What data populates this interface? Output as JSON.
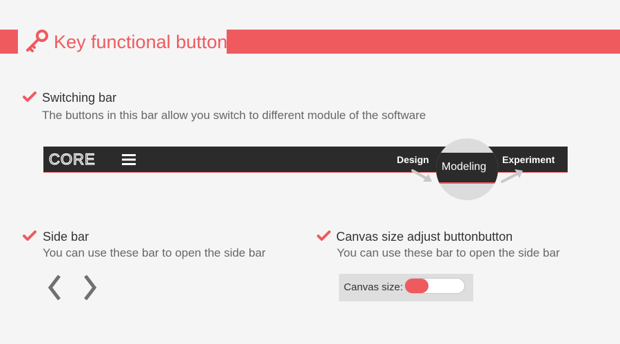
{
  "header": {
    "title": "Key functional button",
    "icon": "key-icon",
    "accent": "#ef5a5f"
  },
  "switching": {
    "title": "Switching bar",
    "desc": "The buttons in this bar allow you switch to different module of the software",
    "navbar": {
      "logo": "CORE",
      "items": [
        "Design",
        "Modeling",
        "Experiment"
      ]
    }
  },
  "sidebar": {
    "title": "Side bar",
    "desc": "You can use these bar to open the side bar"
  },
  "canvas": {
    "title": "Canvas size adjust buttonbutton",
    "desc": "You can use these bar to open the side bar",
    "label": "Canvas size:"
  }
}
